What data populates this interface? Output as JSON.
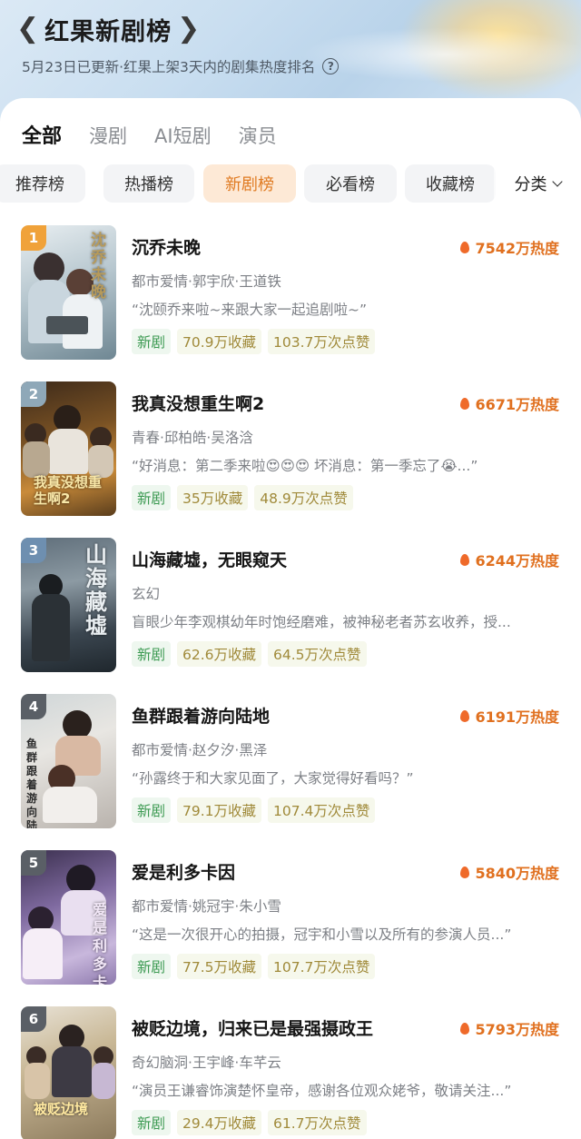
{
  "header": {
    "title": "红果新剧榜",
    "subtitle": "5月23日已更新·红果上架3天内的剧集热度排名",
    "help_icon": "?"
  },
  "tabs": [
    "全部",
    "漫剧",
    "AI短剧",
    "演员"
  ],
  "chips": [
    "推荐榜",
    "热播榜",
    "新剧榜",
    "必看榜",
    "收藏榜"
  ],
  "filter_label": "分类",
  "colors": {
    "accent_orange": "#e07b22",
    "heat_orange": "#e0701f",
    "new_tag_green": "#3c9a52",
    "rank_1": "#f0a23a",
    "rank_2": "#8fa8b8",
    "rank_3": "#6e8fb0",
    "rank_other": "#5a5f66"
  },
  "items": [
    {
      "rank": "1",
      "title": "沉乔未晚",
      "heat": "7542万热度",
      "meta": "都市爱情·郭宇欣·王道铁",
      "quote": "“沈颐乔来啦~来跟大家一起追剧啦~”",
      "tags": [
        "新剧",
        "70.9万收藏",
        "103.7万次点赞"
      ]
    },
    {
      "rank": "2",
      "title": "我真没想重生啊2",
      "heat": "6671万热度",
      "meta": "青春·邱柏皓·吴洛浛",
      "quote": "“好消息：第二季来啦😍😍😍 坏消息：第一季忘了😭...”",
      "tags": [
        "新剧",
        "35万收藏",
        "48.9万次点赞"
      ]
    },
    {
      "rank": "3",
      "title": "山海藏墟，无眼窥天",
      "heat": "6244万热度",
      "meta": "玄幻",
      "quote": "盲眼少年李观棋幼年时饱经磨难，被神秘老者苏玄收养，授...",
      "tags": [
        "新剧",
        "62.6万收藏",
        "64.5万次点赞"
      ]
    },
    {
      "rank": "4",
      "title": "鱼群跟着游向陆地",
      "heat": "6191万热度",
      "meta": "都市爱情·赵夕汐·黑泽",
      "quote": "“孙露终于和大家见面了，大家觉得好看吗？”",
      "tags": [
        "新剧",
        "79.1万收藏",
        "107.4万次点赞"
      ]
    },
    {
      "rank": "5",
      "title": "爱是利多卡因",
      "heat": "5840万热度",
      "meta": "都市爱情·姚冠宇·朱小雪",
      "quote": "“这是一次很开心的拍摄，冠宇和小雪以及所有的参演人员...”",
      "tags": [
        "新剧",
        "77.5万收藏",
        "107.7万次点赞"
      ]
    },
    {
      "rank": "6",
      "title": "被贬边境，归来已是最强摄政王",
      "heat": "5793万热度",
      "meta": "奇幻脑洞·王宇峰·车芊云",
      "quote": "“演员王谦睿饰演楚怀皇帝，感谢各位观众姥爷，敬请关注...”",
      "tags": [
        "新剧",
        "29.4万收藏",
        "61.7万次点赞"
      ]
    }
  ],
  "poster_titles": [
    "沈乔未晚",
    "我真没想重生啊2",
    "山海藏墟",
    "鱼群跟着游向陆地",
    "爱是利多卡因",
    "被贬边境"
  ]
}
